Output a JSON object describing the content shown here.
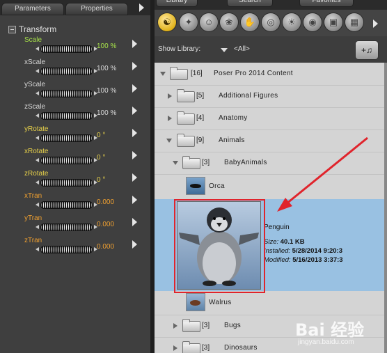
{
  "left_panel": {
    "tabs": [
      "Parameters",
      "Properties"
    ],
    "section": "Transform",
    "params": [
      {
        "name": "Scale",
        "value": "100 %",
        "color": "#a6e04a"
      },
      {
        "name": "xScale",
        "value": "100 %",
        "color": "#d8d8d8"
      },
      {
        "name": "yScale",
        "value": "100 %",
        "color": "#d8d8d8"
      },
      {
        "name": "zScale",
        "value": "100 %",
        "color": "#d8d8d8"
      },
      {
        "name": "yRotate",
        "value": "0 °",
        "color": "#e8d24a"
      },
      {
        "name": "xRotate",
        "value": "0 °",
        "color": "#e8d24a"
      },
      {
        "name": "zRotate",
        "value": "0 °",
        "color": "#e8d24a"
      },
      {
        "name": "xTran",
        "value": "0.000",
        "color": "#f0a030"
      },
      {
        "name": "yTran",
        "value": "0.000",
        "color": "#f0a030"
      },
      {
        "name": "zTran",
        "value": "0.000",
        "color": "#f0a030"
      }
    ]
  },
  "right_panel": {
    "tabs": [
      "Library",
      "Search",
      "Favorites"
    ],
    "category_icons": [
      "figures-icon",
      "poses-icon",
      "faces-icon",
      "hair-icon",
      "hands-icon",
      "props-icon",
      "lights-icon",
      "cameras-icon",
      "materials-icon",
      "scenes-icon"
    ],
    "show_library_label": "Show Library:",
    "show_library_value": "<All>",
    "tree": [
      {
        "count": "[16]",
        "name": "Poser Pro 2014 Content"
      },
      {
        "count": "[5]",
        "name": "Additional Figures"
      },
      {
        "count": "[4]",
        "name": "Anatomy"
      },
      {
        "count": "[9]",
        "name": "Animals"
      },
      {
        "count": "[3]",
        "name": "BabyAnimals"
      },
      {
        "count": "[3]",
        "name": "Bugs"
      },
      {
        "count": "[3]",
        "name": "Dinosaurs"
      }
    ],
    "items": {
      "orca": "Orca",
      "walrus": "Walrus",
      "penguin": {
        "name": "Penguin",
        "size_label": "Size:",
        "size_value": "40.1 KB",
        "installed_label": "Installed:",
        "installed_value": "5/28/2014 9:20:3",
        "modified_label": "Modified:",
        "modified_value": "5/16/2013 3:37:3"
      }
    }
  },
  "watermark": {
    "line1": "Bai 经验",
    "line2": "jingyan.baidu.com"
  },
  "colors": {
    "selection": "#99c1e2",
    "annotation": "#e0242c",
    "active_icon": "#e0b21a"
  }
}
